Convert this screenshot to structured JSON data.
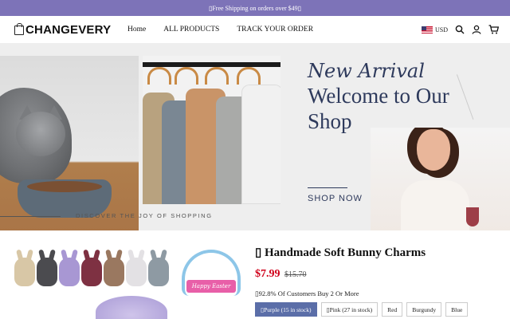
{
  "announcement": "▯Free Shipping on orders over $49▯",
  "header": {
    "logo": "CHANGEVERY",
    "nav": [
      "Home",
      "ALL PRODUCTS",
      "TRACK YOUR ORDER"
    ],
    "currency": "USD",
    "icons": [
      "search-icon",
      "account-icon",
      "cart-icon"
    ]
  },
  "hero": {
    "new_arrival": "New Arrival",
    "welcome_line1": "Welcome to Our",
    "welcome_line2": "Shop",
    "shop_now": "SHOP NOW",
    "discover": "DISCOVER THE JOY OF SHOPPING"
  },
  "product": {
    "title": "▯ Handmade Soft Bunny Charms",
    "price": "$7.99",
    "compare_price": "$15.70",
    "buyers_note": "▯92.8% Of Customers Buy 2 Or More",
    "badge_text": "Happy Easter",
    "variants": [
      {
        "label": "▯Purple (15 in stock)",
        "active": true
      },
      {
        "label": "▯Pink (27 in stock)",
        "active": false
      },
      {
        "label": "Red",
        "active": false
      },
      {
        "label": "Burgundy",
        "active": false
      },
      {
        "label": "Blue",
        "active": false
      }
    ]
  },
  "colors": {
    "announcement_bg": "#7d73b8",
    "hero_text": "#2e3a5c",
    "price": "#d0021b",
    "variant_active": "#5b6ea8"
  }
}
